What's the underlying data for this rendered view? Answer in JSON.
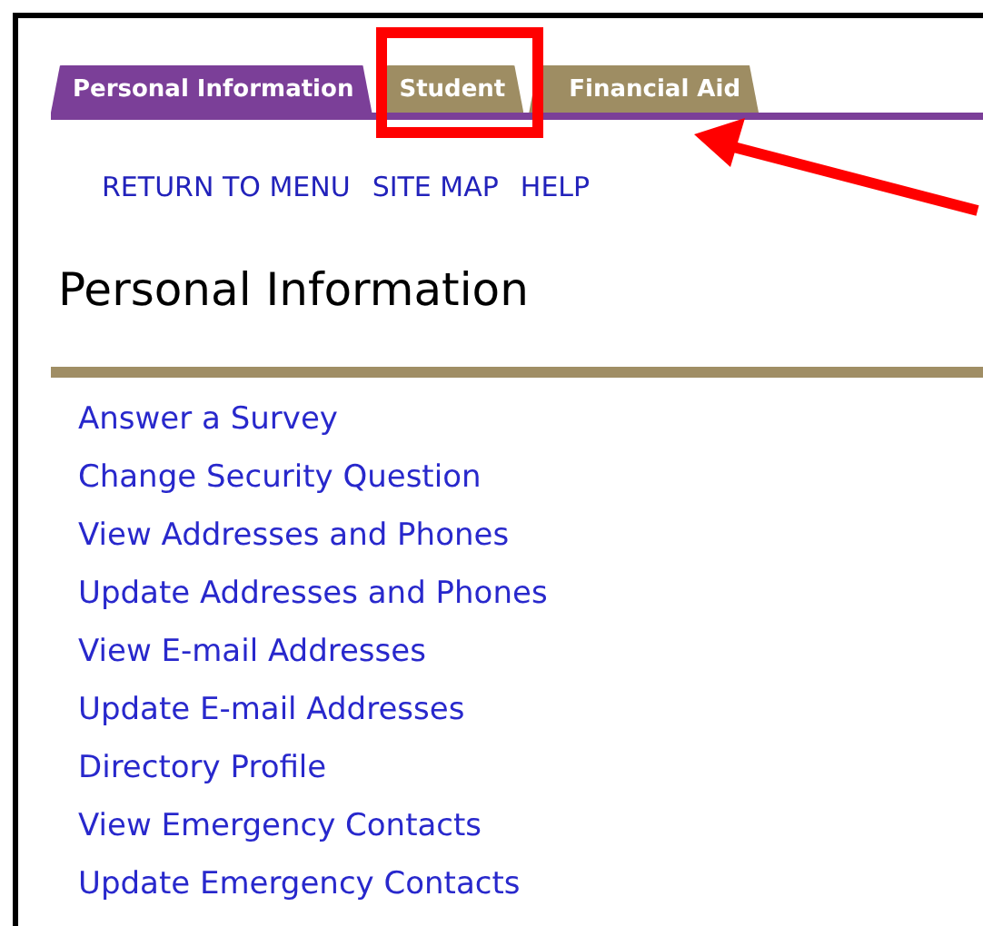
{
  "tabs": [
    {
      "label": "Personal Information",
      "selected": true
    },
    {
      "label": "Student",
      "selected": false
    },
    {
      "label": "Financial Aid",
      "selected": false
    }
  ],
  "nav_links": [
    "RETURN TO MENU",
    "SITE MAP",
    "HELP"
  ],
  "heading": "Personal Information",
  "menu_links": [
    "Answer a Survey",
    "Change Security Question",
    "View Addresses and Phones",
    "Update Addresses and Phones",
    "View E-mail Addresses",
    "Update E-mail Addresses",
    "Directory Profile",
    "View Emergency Contacts",
    "Update Emergency Contacts"
  ]
}
